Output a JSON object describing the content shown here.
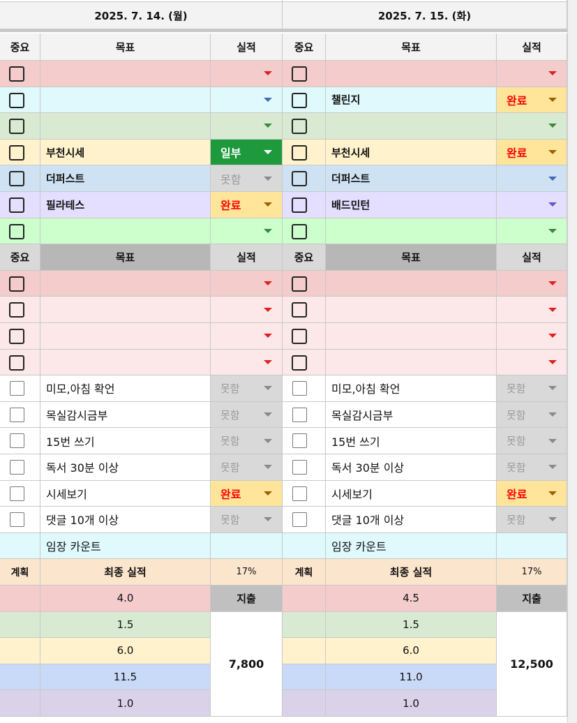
{
  "days": [
    {
      "date": "2025. 7. 14. (월)",
      "sec1": [
        {
          "goal": "",
          "perf": "",
          "bg": "#f4cccc",
          "arrow": "#e02020"
        },
        {
          "goal": "",
          "perf": "",
          "bg": "#dff9fc",
          "arrow": "#3d6db0"
        },
        {
          "goal": "",
          "perf": "",
          "bg": "#d9ead3",
          "arrow": "#3b8a3b"
        },
        {
          "goal": "부천시세",
          "perf": "일부",
          "bg": "#fff2cc",
          "arrow": "#ffffff"
        },
        {
          "goal": "더퍼스트",
          "perf": "못함",
          "bg": "#cfe2f3",
          "arrow": "#888888"
        },
        {
          "goal": "필라테스",
          "perf": "완료",
          "bg": "#e4deff",
          "arrow": "#b06000"
        },
        {
          "goal": "",
          "perf": "",
          "bg": "#ccffcc",
          "arrow": "#3b8a3b"
        }
      ],
      "sec2": [
        {
          "goal": "",
          "perf": ""
        },
        {
          "goal": "",
          "perf": ""
        },
        {
          "goal": "",
          "perf": ""
        },
        {
          "goal": "",
          "perf": ""
        }
      ],
      "sec3": [
        {
          "goal": "미모,아침 확언",
          "perf": "못함"
        },
        {
          "goal": "목실감시금부",
          "perf": "못함"
        },
        {
          "goal": "15번 쓰기",
          "perf": "못함"
        },
        {
          "goal": "독서 30분 이상",
          "perf": "못함"
        },
        {
          "goal": "시세보기",
          "perf": "완료"
        },
        {
          "goal": "댓글 10개 이상",
          "perf": "못함"
        }
      ],
      "count_label": "임장 카운트",
      "percent": "17%",
      "plans": [
        "4.0",
        "1.5",
        "6.0",
        "11.5",
        "1.0"
      ],
      "expense": "7,800"
    },
    {
      "date": "2025. 7. 15. (화)",
      "sec1": [
        {
          "goal": "",
          "perf": "",
          "bg": "#f4cccc",
          "arrow": "#e02020"
        },
        {
          "goal": "챌린지",
          "perf": "완료",
          "bg": "#dff9fc",
          "arrow": "#b06000"
        },
        {
          "goal": "",
          "perf": "",
          "bg": "#d9ead3",
          "arrow": "#3b8a3b"
        },
        {
          "goal": "부천시세",
          "perf": "완료",
          "bg": "#fff2cc",
          "arrow": "#b06000"
        },
        {
          "goal": "더퍼스트",
          "perf": "",
          "bg": "#cfe2f3",
          "arrow": "#3d6db0"
        },
        {
          "goal": "배드민턴",
          "perf": "",
          "bg": "#e4deff",
          "arrow": "#6a50d0"
        },
        {
          "goal": "",
          "perf": "",
          "bg": "#ccffcc",
          "arrow": "#3b8a3b"
        }
      ],
      "sec2": [
        {
          "goal": "",
          "perf": ""
        },
        {
          "goal": "",
          "perf": ""
        },
        {
          "goal": "",
          "perf": ""
        },
        {
          "goal": "",
          "perf": ""
        }
      ],
      "sec3": [
        {
          "goal": "미모,아침 확언",
          "perf": "못함"
        },
        {
          "goal": "목실감시금부",
          "perf": "못함"
        },
        {
          "goal": "15번 쓰기",
          "perf": "못함"
        },
        {
          "goal": "독서 30분 이상",
          "perf": "못함"
        },
        {
          "goal": "시세보기",
          "perf": "완료"
        },
        {
          "goal": "댓글 10개 이상",
          "perf": "못함"
        }
      ],
      "count_label": "임장 카운트",
      "percent": "17%",
      "plans": [
        "4.5",
        "1.5",
        "6.0",
        "11.0",
        "1.0"
      ],
      "expense": "12,500"
    }
  ],
  "headers": {
    "importance": "중요",
    "goal": "목표",
    "performance": "실적"
  },
  "summary": {
    "plan_label": "계획",
    "final_label": "최종 실적",
    "expense_label": "지출"
  },
  "status_styles": {
    "일부": {
      "bg": "#1e9a3c",
      "color": "#ffffff",
      "arrow": "#ffffff"
    },
    "완료": {
      "bg": "#ffe599",
      "color": "#ff0000",
      "arrow": "#a06000"
    },
    "못함": {
      "bg": "#d9d9d9",
      "color": "#9a9a9a",
      "arrow": "#8a8a8a"
    }
  },
  "plan_colors": [
    "#f4cccc",
    "#d9ead3",
    "#fff2cc",
    "#c9daf8",
    "#d9d2e9"
  ]
}
